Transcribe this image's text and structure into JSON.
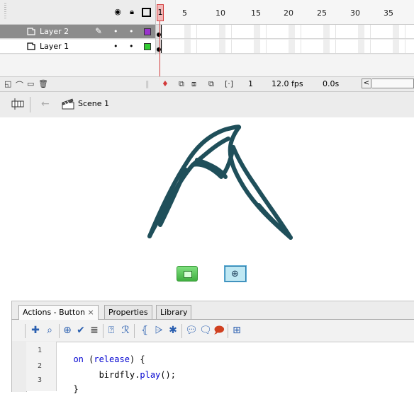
{
  "timeline": {
    "header_icons": [
      "eye-icon",
      "lock-icon",
      "outline-icon"
    ],
    "frame_numbers": [
      "5",
      "10",
      "15",
      "20",
      "25",
      "30",
      "35"
    ],
    "playhead_frame": "1",
    "layers": [
      {
        "name": "Layer 2",
        "selected": true,
        "color": "#9933cc"
      },
      {
        "name": "Layer 1",
        "selected": false,
        "color": "#33cc33"
      }
    ],
    "footer": {
      "current_frame": "1",
      "frame_rate": "12.0 fps",
      "elapsed_time": "0.0s"
    }
  },
  "editbar": {
    "scene_label": "Scene 1"
  },
  "stage": {
    "drawing_color": "#1f4f5a"
  },
  "actions_panel": {
    "tabs": [
      {
        "label": "Actions - Button",
        "active": true,
        "close": "×"
      },
      {
        "label": "Properties",
        "active": false
      },
      {
        "label": "Library",
        "active": false
      }
    ],
    "code_lines": [
      {
        "num": "1",
        "parts": [
          {
            "t": "on",
            "c": "kw"
          },
          {
            "t": " (",
            "c": "id"
          },
          {
            "t": "release",
            "c": "kw"
          },
          {
            "t": ") {",
            "c": "id"
          }
        ]
      },
      {
        "num": "2",
        "parts": [
          {
            "t": "     birdfly.",
            "c": "id"
          },
          {
            "t": "play",
            "c": "fn"
          },
          {
            "t": "();",
            "c": "id"
          }
        ]
      },
      {
        "num": "3",
        "parts": [
          {
            "t": "}",
            "c": "id"
          }
        ]
      }
    ]
  }
}
